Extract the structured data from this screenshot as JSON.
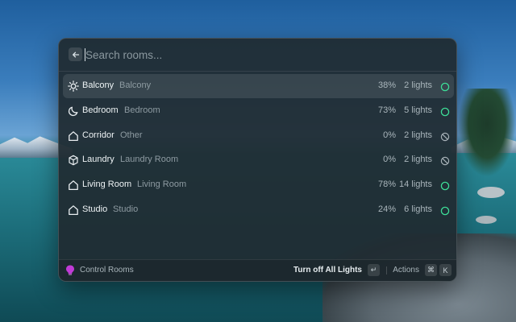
{
  "search": {
    "placeholder": "Search rooms..."
  },
  "rooms": [
    {
      "name": "Balcony",
      "type": "Balcony",
      "brightness": "38%",
      "lights": "2 lights",
      "icon": "sun-icon",
      "status": "on",
      "selected": true
    },
    {
      "name": "Bedroom",
      "type": "Bedroom",
      "brightness": "73%",
      "lights": "5 lights",
      "icon": "moon-icon",
      "status": "on",
      "selected": false
    },
    {
      "name": "Corridor",
      "type": "Other",
      "brightness": "0%",
      "lights": "2 lights",
      "icon": "home-icon",
      "status": "off",
      "selected": false
    },
    {
      "name": "Laundry",
      "type": "Laundry Room",
      "brightness": "0%",
      "lights": "2 lights",
      "icon": "cube-icon",
      "status": "off",
      "selected": false
    },
    {
      "name": "Living Room",
      "type": "Living Room",
      "brightness": "78%",
      "lights": "14 lights",
      "icon": "home-icon",
      "status": "on",
      "selected": false
    },
    {
      "name": "Studio",
      "type": "Studio",
      "brightness": "24%",
      "lights": "6 lights",
      "icon": "home-icon",
      "status": "on",
      "selected": false
    }
  ],
  "footer": {
    "app_name": "Control Rooms",
    "primary_action": "Turn off All Lights",
    "primary_key": "↵",
    "actions_label": "Actions",
    "actions_key_1": "⌘",
    "actions_key_2": "K"
  },
  "colors": {
    "on": "#3ddc97",
    "off": "#a7b2b8",
    "accent": "#c03bd6"
  }
}
